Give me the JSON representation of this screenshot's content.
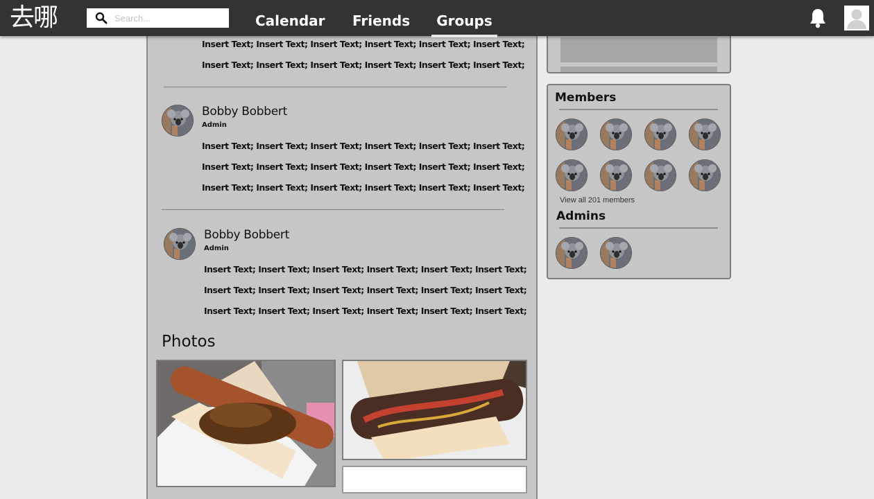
{
  "header": {
    "logo": "去哪",
    "search_placeholder": "Search...",
    "tabs": [
      {
        "label": "Calendar"
      },
      {
        "label": "Friends"
      },
      {
        "label": "Groups",
        "active": true
      }
    ],
    "icons": {
      "notifications": "bell-icon",
      "profile": "user-avatar-icon",
      "search": "search-icon"
    }
  },
  "posts": [
    {
      "lines": [
        "Insert Text; Insert Text; Insert Text; Insert Text; Insert Text; Insert Text;",
        "Insert Text; Insert Text; Insert Text; Insert Text;  Insert Text; Insert Text;"
      ]
    },
    {
      "author": "Bobby Bobbert",
      "role": "Admin",
      "lines": [
        "Insert Text; Insert Text; Insert Text; Insert Text; Insert Text; Insert Text;",
        "Insert Text; Insert Text; Insert Text; Insert Text; Insert Text; Insert Text;",
        "Insert Text; Insert Text; Insert Text; Insert Text;  Insert Text; Insert Text;"
      ]
    },
    {
      "author": "Bobby Bobbert",
      "role": "Admin",
      "lines": [
        "Insert Text; Insert Text; Insert Text; Insert Text; Insert Text; Insert Text;",
        "Insert Text; Insert Text; Insert Text; Insert Text; Insert Text; Insert Text;",
        "Insert Text; Insert Text; Insert Text; Insert Text;  Insert Text; Insert Text;"
      ]
    }
  ],
  "photos": {
    "title": "Photos",
    "items": [
      "hotdog-photo-1",
      "hotdog-photo-2",
      "photo-3"
    ]
  },
  "sidebar": {
    "members_title": "Members",
    "members_count": 8,
    "view_all_label": "View all 201 members",
    "admins_title": "Admins",
    "admins_count": 2
  },
  "colors": {
    "topbar": "#333333",
    "page_bg": "#ebebeb",
    "panel_bg": "#c6c6c6"
  }
}
